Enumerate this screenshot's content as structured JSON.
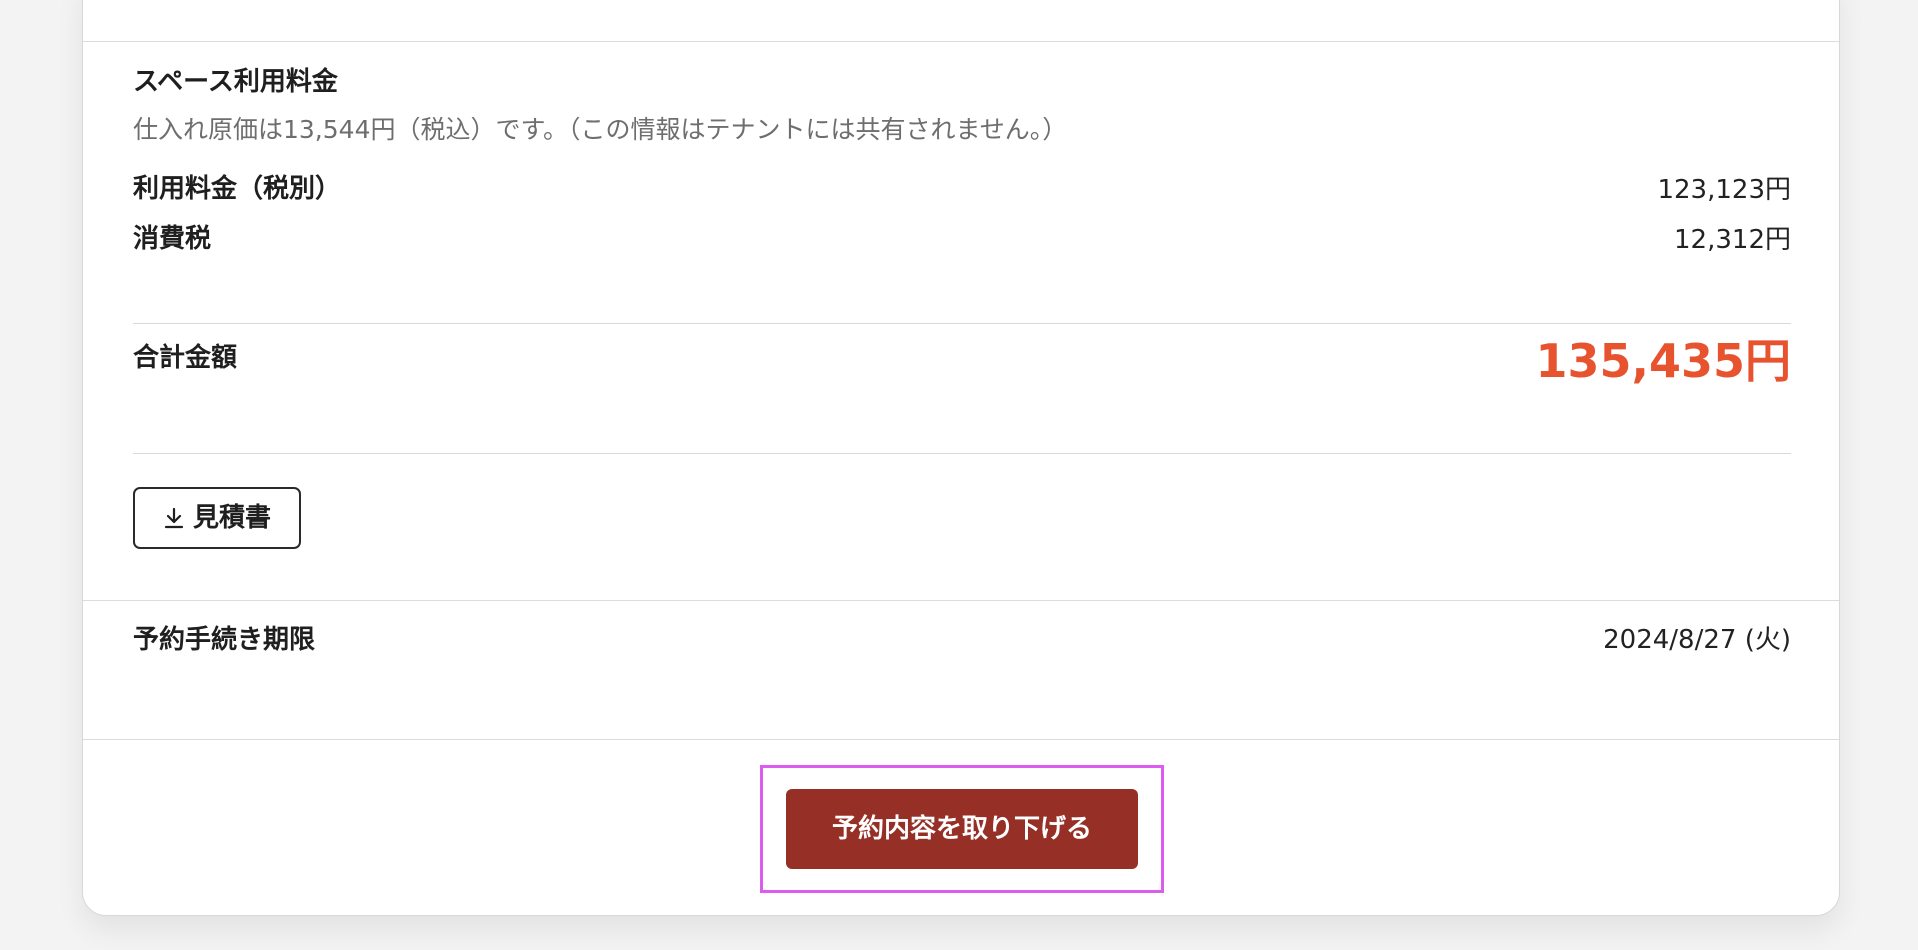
{
  "fee_section": {
    "heading": "スペース利用料金",
    "note": "仕入れ原価は13,544円（税込）です。（この情報はテナントには共有されません。）",
    "rows": [
      {
        "label": "利用料金（税別）",
        "value": "123,123円"
      },
      {
        "label": "消費税",
        "value": "12,312円"
      }
    ],
    "total": {
      "label": "合計金額",
      "value": "135,435円",
      "color": "#e8532f"
    },
    "estimate_button": {
      "label": "見積書",
      "icon": "download-icon"
    }
  },
  "deadline": {
    "label": "予約手続き期限",
    "value": "2024/8/27 (火)"
  },
  "actions": {
    "withdraw_label": "予約内容を取り下げる",
    "withdraw_color": "#963027",
    "highlight_color": "#dd5cf0"
  }
}
